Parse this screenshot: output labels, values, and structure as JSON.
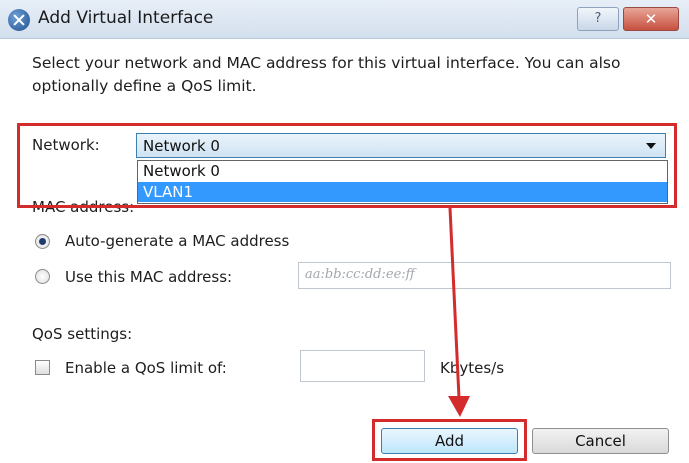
{
  "window": {
    "title": "Add Virtual Interface",
    "help_label": "?",
    "close_label": "✕"
  },
  "instruction": "Select your network and MAC address for this virtual interface. You can also optionally define a QoS limit.",
  "network": {
    "label": "Network:",
    "selected": "Network 0",
    "options": [
      "Network 0",
      "VLAN1"
    ],
    "highlighted": "VLAN1"
  },
  "mac": {
    "section_label": "MAC address:",
    "auto_label": "Auto-generate a MAC address",
    "use_label": "Use this MAC address:",
    "placeholder": "aa:bb:cc:dd:ee:ff",
    "selected_option": "auto"
  },
  "qos": {
    "section_label": "QoS settings:",
    "enable_label": "Enable a QoS limit of:",
    "value": "",
    "unit": "Kbytes/s",
    "enabled": false
  },
  "buttons": {
    "add": "Add",
    "cancel": "Cancel"
  },
  "annotation": {
    "color": "#d42c2c"
  }
}
